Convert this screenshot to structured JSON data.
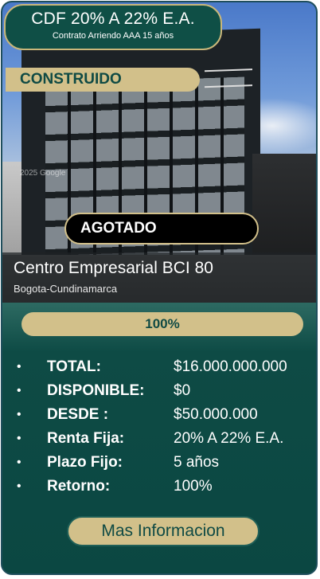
{
  "rate": {
    "title": "CDF 20% A 22% E.A.",
    "subtitle": "Contrato Arriendo AAA 15 años"
  },
  "status": "CONSTRUIDO",
  "badge": "AGOTADO",
  "photo": {
    "watermark": "2025 Google"
  },
  "project": {
    "name": "Centro Empresarial BCI 80",
    "location": "Bogota-Cundinamarca"
  },
  "progress": {
    "label": "100%",
    "value": 1.0
  },
  "details": [
    {
      "label": "TOTAL:",
      "value": "$16.000.000.000"
    },
    {
      "label": "DISPONIBLE:",
      "value": "$0"
    },
    {
      "label": "DESDE :",
      "value": "$50.000.000"
    },
    {
      "label": "Renta Fija:",
      "value": "20% A 22% E.A."
    },
    {
      "label": "Plazo Fijo:",
      "value": "5 años"
    },
    {
      "label": "Retorno:",
      "value": "100%"
    }
  ],
  "cta": {
    "label": "Mas Informacion"
  },
  "colors": {
    "teal": "#0b4a45",
    "gold": "#d2c08a",
    "black": "#000000"
  }
}
